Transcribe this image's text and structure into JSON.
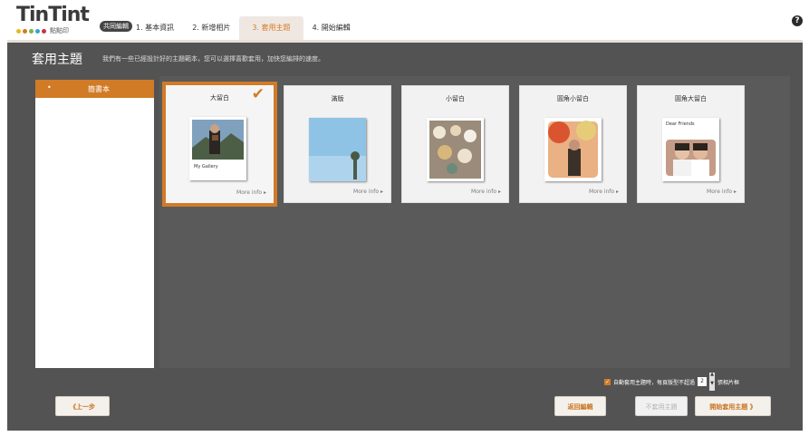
{
  "app": {
    "logo": "TinTint",
    "logo_small": "點點印",
    "logo_badge": "共同編輯",
    "dot_colors": [
      "#e8b820",
      "#d17b27",
      "#7ab648",
      "#3aa0d8",
      "#c8334b"
    ]
  },
  "steps": [
    {
      "label": "1. 基本資訊",
      "active": false
    },
    {
      "label": "2. 新增相片",
      "active": false
    },
    {
      "label": "3. 套用主題",
      "active": true
    },
    {
      "label": "4. 開始編輯",
      "active": false
    }
  ],
  "help_icon": "?",
  "page": {
    "title": "套用主題",
    "description": "我們有一些已經設計好的主題範本，您可以選擇喜歡套用，加快您編排的速度。"
  },
  "sidebar": {
    "items": [
      {
        "label": "簡書本",
        "selected": true
      }
    ]
  },
  "themes": [
    {
      "title": "大留白",
      "more": "More info ▸",
      "selected": true,
      "thumb_caption": "My Gallery"
    },
    {
      "title": "滿版",
      "more": "More info ▸",
      "selected": false
    },
    {
      "title": "小留白",
      "more": "More info ▸",
      "selected": false
    },
    {
      "title": "圓角小留白",
      "more": "More info ▸",
      "selected": false
    },
    {
      "title": "圓角大留白",
      "more": "More info ▸",
      "selected": false,
      "thumb_caption": "Dear Friends"
    }
  ],
  "check_icon": "✔",
  "auto_apply": {
    "checked": true,
    "label_before": "自動套用主題時，每頁版型不超過",
    "value": "2",
    "label_after": "張相片框"
  },
  "buttons": {
    "prev": "《上一步",
    "back": "返回編輯",
    "no_apply": "不套用主題",
    "apply": "開始套用主題 》"
  },
  "colors": {
    "accent": "#d17b27",
    "panel": "#535353",
    "content": "#5a5a5a"
  }
}
